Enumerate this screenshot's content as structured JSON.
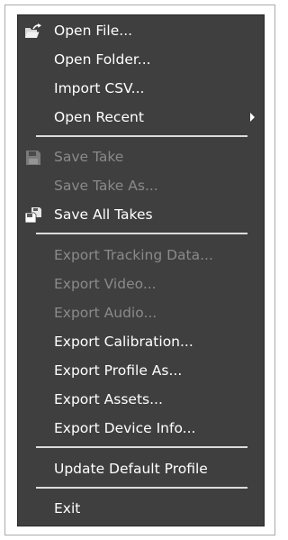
{
  "menu": {
    "open_file": {
      "label": "Open File...",
      "icon": "open-file-icon"
    },
    "open_folder": {
      "label": "Open Folder..."
    },
    "import_csv": {
      "label": "Import CSV..."
    },
    "open_recent": {
      "label": "Open Recent",
      "submenu_icon": "chevron-right-icon"
    },
    "save_take": {
      "label": "Save Take",
      "icon": "save-icon",
      "enabled": false
    },
    "save_take_as": {
      "label": "Save Take As...",
      "enabled": false
    },
    "save_all_takes": {
      "label": "Save All Takes",
      "icon": "save-all-icon"
    },
    "export_tracking_data": {
      "label": "Export Tracking Data...",
      "enabled": false
    },
    "export_video": {
      "label": "Export Video...",
      "enabled": false
    },
    "export_audio": {
      "label": "Export Audio...",
      "enabled": false
    },
    "export_calibration": {
      "label": "Export Calibration..."
    },
    "export_profile_as": {
      "label": "Export Profile As..."
    },
    "export_assets": {
      "label": "Export Assets..."
    },
    "export_device_info": {
      "label": "Export Device Info..."
    },
    "update_default_profile": {
      "label": "Update Default Profile"
    },
    "exit": {
      "label": "Exit"
    }
  },
  "colors": {
    "menu_background": "#3f3f3f",
    "text_enabled": "#ffffff",
    "text_disabled": "#8a8a8a",
    "separator": "#dcdcdc"
  }
}
